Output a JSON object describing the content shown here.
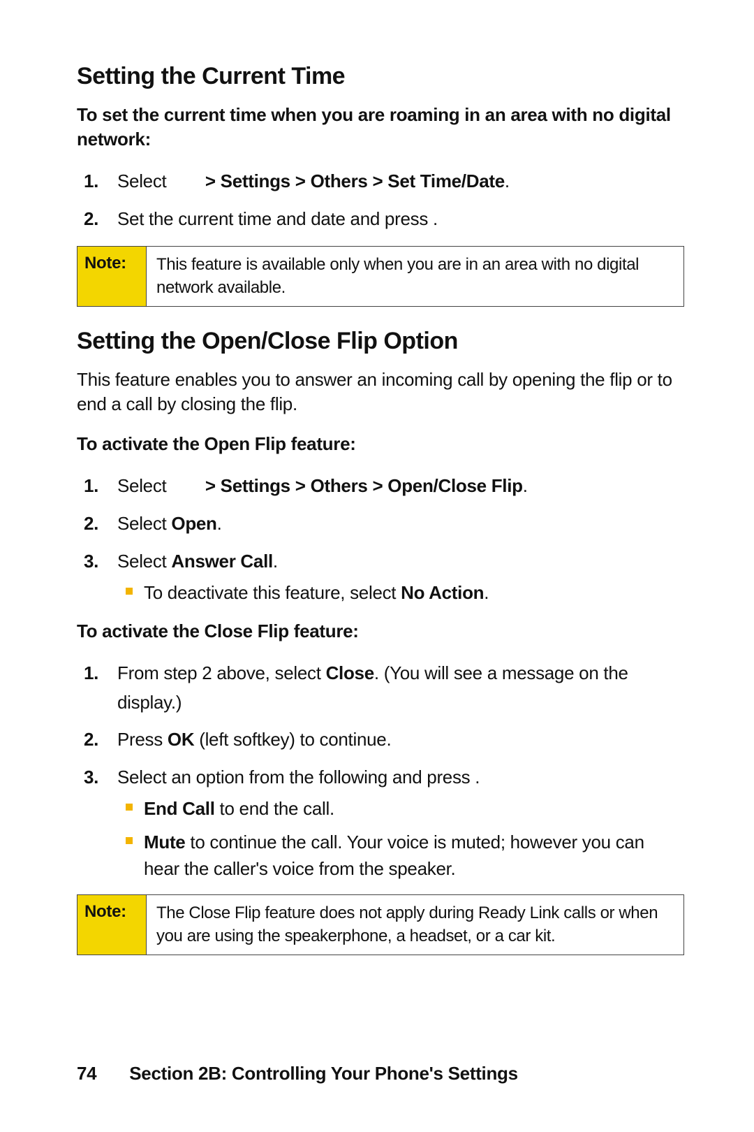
{
  "section1": {
    "heading": "Setting the Current Time",
    "intro": "To set the current time when you are roaming in an area with no digital network:",
    "step1_a": "Select ",
    "step1_b": " > Settings > Others > Set Time/Date",
    "step1_c": ".",
    "step2": "Set the current time and date and press        .",
    "note_label": "Note:",
    "note_text": "This feature is available only when you are in an area with no digital network available."
  },
  "section2": {
    "heading": "Setting the Open/Close Flip Option",
    "intro": "This feature enables you to answer an incoming call by opening the flip or to end a call by closing the flip.",
    "open_h": "To activate the Open Flip feature:",
    "o1_a": "Select ",
    "o1_b": " > Settings > Others > Open/Close Flip",
    "o1_c": ".",
    "o2_a": "Select ",
    "o2_b": "Open",
    "o2_c": ".",
    "o3_a": "Select ",
    "o3_b": "Answer Call",
    "o3_c": ".",
    "o3_sub_a": "To deactivate this feature, select ",
    "o3_sub_b": "No Action",
    "o3_sub_c": ".",
    "close_h": "To activate the Close Flip feature:",
    "c1_a": "From step 2 above, select ",
    "c1_b": "Close",
    "c1_c": ". (You will see a message on the display.)",
    "c2_a": "Press ",
    "c2_b": "OK",
    "c2_c": " (left softkey) to continue.",
    "c3": "Select an option from the following and press        .",
    "c3_s1_b": "End Call",
    "c3_s1_t": " to end the call.",
    "c3_s2_b": "Mute",
    "c3_s2_t": " to continue the call. Your voice is muted; however you can hear the caller's voice from the speaker.",
    "note_label": "Note:",
    "note_text": "The Close Flip feature does not apply during Ready Link calls or when you are using the speakerphone, a headset, or a car kit."
  },
  "footer": {
    "page": "74",
    "title": "Section 2B: Controlling Your Phone's Settings"
  }
}
